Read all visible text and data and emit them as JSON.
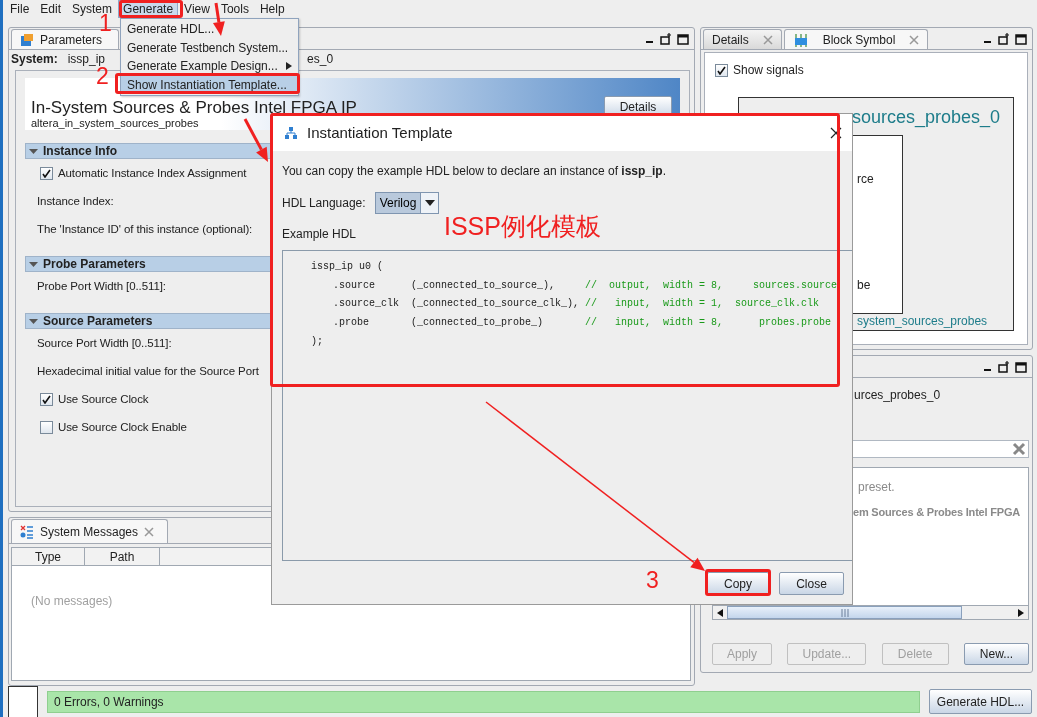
{
  "menubar": [
    {
      "label": "File",
      "selected": false
    },
    {
      "label": "Edit",
      "selected": false
    },
    {
      "label": "System",
      "selected": false
    },
    {
      "label": "Generate",
      "selected": true
    },
    {
      "label": "View",
      "selected": false
    },
    {
      "label": "Tools",
      "selected": false
    },
    {
      "label": "Help",
      "selected": false
    }
  ],
  "generate_menu": [
    {
      "label": "Generate HDL...",
      "selected": false,
      "submenu": false
    },
    {
      "label": "Generate Testbench System...",
      "selected": false,
      "submenu": false
    },
    {
      "label": "Generate Example Design...",
      "selected": false,
      "submenu": true
    },
    {
      "label": "Show Instantiation Template...",
      "selected": true,
      "submenu": false
    }
  ],
  "parameters_panel": {
    "tab": "Parameters",
    "system_label": "System:",
    "system_value": "issp_ip",
    "path_fragment": "es_0",
    "title": "In-System Sources & Probes Intel FPGA IP",
    "subtitle": "altera_in_system_sources_probes",
    "details_button": "Details",
    "sections": [
      {
        "title": "Instance Info",
        "expanded": true,
        "rows": [
          {
            "kind": "checkbox",
            "label": "Automatic Instance Index Assignment",
            "checked": true
          },
          {
            "kind": "label",
            "label": "Instance Index:"
          },
          {
            "kind": "label",
            "label": "The 'Instance ID' of this instance (optional):"
          }
        ]
      },
      {
        "title": "Probe Parameters",
        "expanded": true,
        "rows": [
          {
            "kind": "label",
            "label": "Probe Port Width [0..511]:"
          }
        ]
      },
      {
        "title": "Source Parameters",
        "expanded": true,
        "rows": [
          {
            "kind": "label",
            "label": "Source Port Width [0..511]:"
          },
          {
            "kind": "label",
            "label": "Hexadecimal initial value for the Source Port"
          },
          {
            "kind": "checkbox",
            "label": "Use Source Clock",
            "checked": true
          },
          {
            "kind": "checkbox",
            "label": "Use Source Clock Enable",
            "checked": false
          }
        ]
      }
    ]
  },
  "symbol_panel": {
    "tabs": [
      {
        "label": "Details",
        "selected": false
      },
      {
        "label": "Block Symbol",
        "selected": true
      }
    ],
    "show_signals": {
      "label": "Show signals",
      "checked": true
    },
    "block_title": "sources_probes_0",
    "ports": [
      "rce",
      "be"
    ],
    "block_footer": "system_sources_probes"
  },
  "presets_panel": {
    "name_fragment": "urces_probes_0",
    "list": [
      {
        "text": "preset.",
        "bold": false
      },
      {
        "text": "em Sources & Probes Intel FPGA",
        "bold": true
      }
    ],
    "buttons": [
      {
        "label": "Apply",
        "disabled": true
      },
      {
        "label": "Update...",
        "disabled": true
      },
      {
        "label": "Delete",
        "disabled": true
      },
      {
        "label": "New...",
        "disabled": false
      }
    ]
  },
  "messages_panel": {
    "tab": "System Messages",
    "columns": [
      "Type",
      "Path"
    ],
    "empty_text": "(No messages)"
  },
  "status_bar": {
    "text": "0 Errors, 0 Warnings",
    "button": "Generate HDL..."
  },
  "dialog": {
    "title": "Instantiation Template",
    "intro": "You can copy the example HDL below to declare an instance of **issp_ip**.",
    "language_label": "HDL Language:",
    "language_value": "Verilog",
    "example_label": "Example HDL",
    "code": [
      {
        "kind": "open",
        "code": "issp_ip u0 ("
      },
      {
        "kind": "port",
        "code": ".source      (_connected_to_source_),     ",
        "comment": "//  output,  width = 8,     sources.source"
      },
      {
        "kind": "port",
        "code": ".source_clk  (_connected_to_source_clk_), ",
        "comment": "//   input,  width = 1,  source_clk.clk"
      },
      {
        "kind": "port",
        "code": ".probe       (_connected_to_probe_)       ",
        "comment": "//   input,  width = 8,      probes.probe"
      },
      {
        "kind": "open",
        "code": ");"
      }
    ],
    "buttons": [
      "Copy",
      "Close"
    ]
  },
  "annotations": {
    "steps": [
      "1",
      "2",
      "3"
    ],
    "caption": "ISSP例化模板"
  }
}
